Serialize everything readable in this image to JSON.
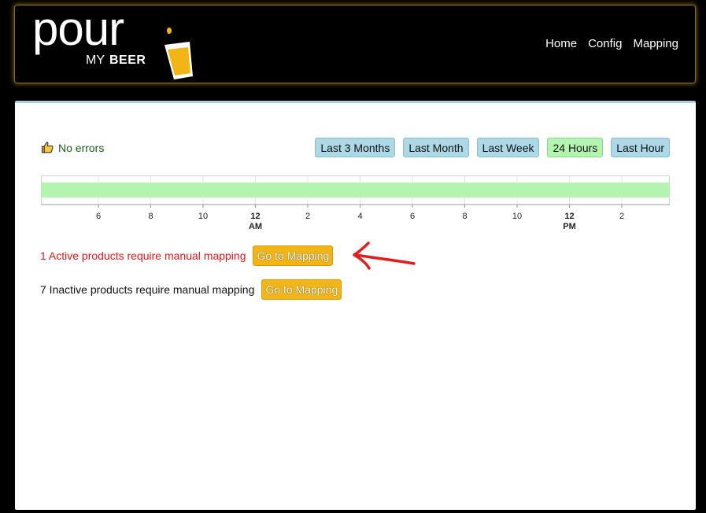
{
  "header": {
    "logo": {
      "word": "pour",
      "my": "MY",
      "beer": "BEER"
    },
    "nav": [
      {
        "label": "Home"
      },
      {
        "label": "Config"
      },
      {
        "label": "Mapping"
      }
    ]
  },
  "status": {
    "icon": "thumbs-up-icon",
    "text": "No errors"
  },
  "range_buttons": [
    {
      "label": "Last 3 Months",
      "active": false
    },
    {
      "label": "Last Month",
      "active": false
    },
    {
      "label": "Last Week",
      "active": false
    },
    {
      "label": "24 Hours",
      "active": true
    },
    {
      "label": "Last Hour",
      "active": false
    }
  ],
  "timeline": {
    "ticks": [
      {
        "label": "6",
        "sub": "",
        "bold": false
      },
      {
        "label": "8",
        "sub": "",
        "bold": false
      },
      {
        "label": "10",
        "sub": "",
        "bold": false
      },
      {
        "label": "12",
        "sub": "AM",
        "bold": true
      },
      {
        "label": "2",
        "sub": "",
        "bold": false
      },
      {
        "label": "4",
        "sub": "",
        "bold": false
      },
      {
        "label": "6",
        "sub": "",
        "bold": false
      },
      {
        "label": "8",
        "sub": "",
        "bold": false
      },
      {
        "label": "10",
        "sub": "",
        "bold": false
      },
      {
        "label": "12",
        "sub": "PM",
        "bold": true
      },
      {
        "label": "2",
        "sub": "",
        "bold": false
      }
    ],
    "bar_color": "#b3f5b0"
  },
  "mapping": {
    "active": {
      "text": "1 Active products require manual mapping",
      "button": "Go to Mapping"
    },
    "inactive": {
      "text": "7 Inactive products require manual mapping",
      "button": "Go to Mapping"
    }
  },
  "colors": {
    "accent_gold": "#f2b516",
    "range_button": "#add8e6",
    "range_button_active": "#b3f5b0",
    "error_red": "#e51919",
    "ok_green": "#1a5e1a",
    "annotation_arrow": "#e01e1e"
  }
}
